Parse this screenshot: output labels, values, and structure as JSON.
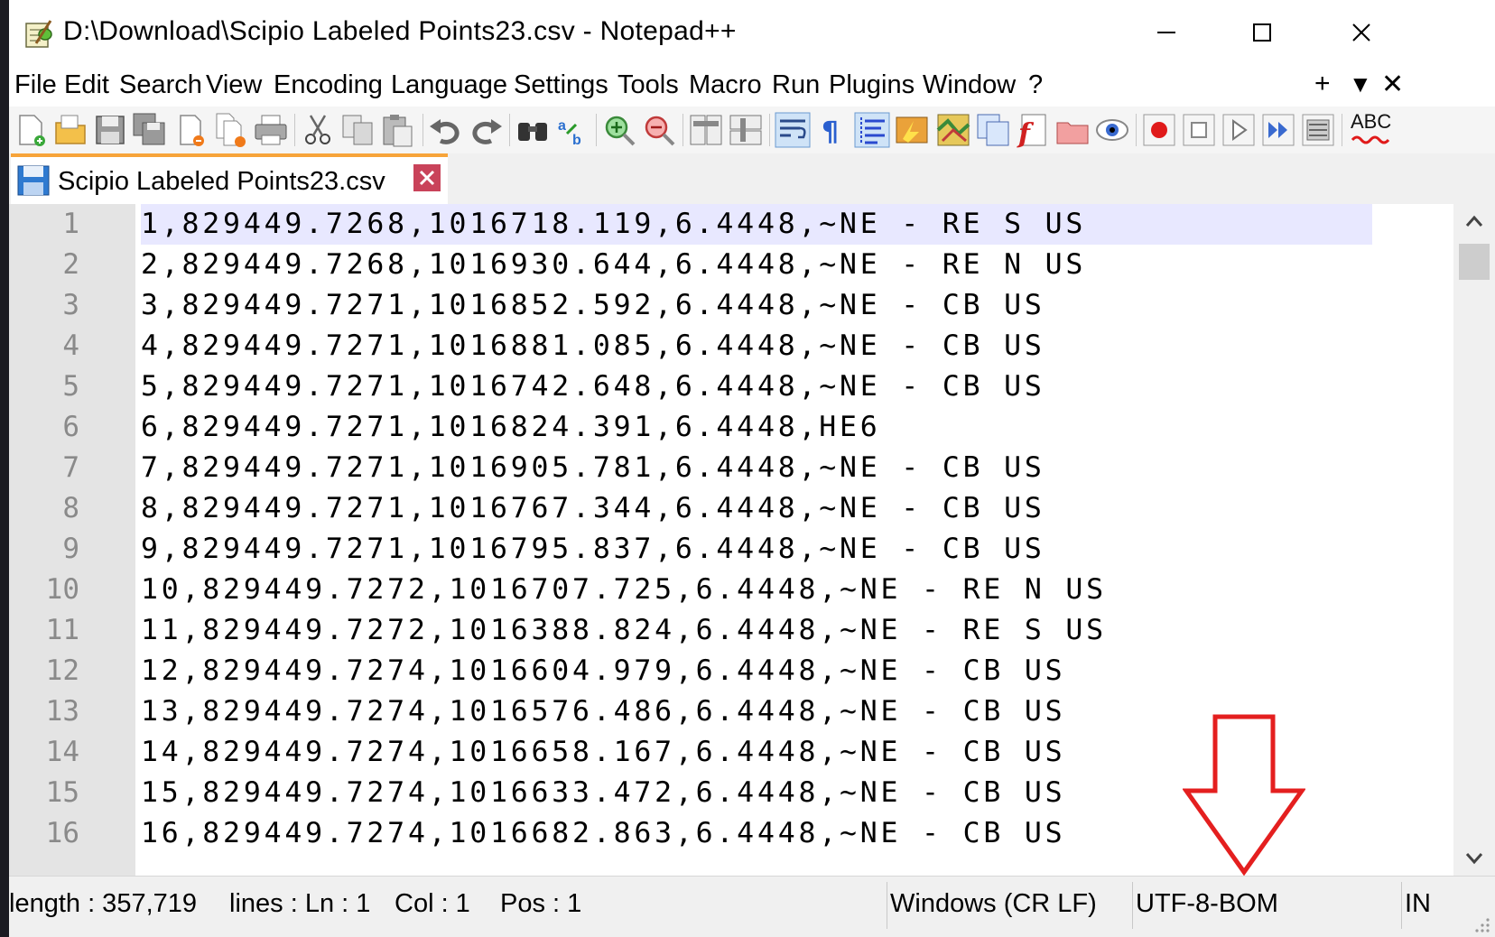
{
  "window": {
    "title": "D:\\Download\\Scipio Labeled Points23.csv - Notepad++"
  },
  "menu": [
    "File",
    "Edit",
    "Search",
    "View",
    "Encoding",
    "Language",
    "Settings",
    "Tools",
    "Macro",
    "Run",
    "Plugins",
    "Window",
    "?"
  ],
  "menu_right": {
    "add": "+",
    "down": "▼",
    "close": "✕"
  },
  "toolbar": {
    "icons": [
      "new-file-icon",
      "open-file-icon",
      "save-icon",
      "save-all-icon",
      "close-icon",
      "close-all-icon",
      "print-icon",
      "cut-icon",
      "copy-icon",
      "paste-icon",
      "undo-icon",
      "redo-icon",
      "find-icon",
      "replace-icon",
      "zoom-in-icon",
      "zoom-out-icon",
      "sync-vertical-icon",
      "sync-horizontal-icon",
      "word-wrap-icon",
      "show-all-chars-icon",
      "indent-guide-icon",
      "udl-icon",
      "doc-map-icon",
      "doc-list-icon",
      "function-list-icon",
      "folder-workspace-icon",
      "monitoring-icon",
      "record-macro-icon",
      "stop-record-icon",
      "play-macro-icon",
      "run-macro-multiple-icon",
      "save-macro-icon",
      "spellcheck-icon"
    ],
    "spellcheck_label": "ABC"
  },
  "tab": {
    "label": "Scipio Labeled Points23.csv"
  },
  "editor": {
    "lines": [
      {
        "n": "1",
        "text": "1,829449.7268,1016718.119,6.4448,~NE - RE S US"
      },
      {
        "n": "2",
        "text": "2,829449.7268,1016930.644,6.4448,~NE - RE N US"
      },
      {
        "n": "3",
        "text": "3,829449.7271,1016852.592,6.4448,~NE - CB US"
      },
      {
        "n": "4",
        "text": "4,829449.7271,1016881.085,6.4448,~NE - CB US"
      },
      {
        "n": "5",
        "text": "5,829449.7271,1016742.648,6.4448,~NE - CB US"
      },
      {
        "n": "6",
        "text": "6,829449.7271,1016824.391,6.4448,HE6"
      },
      {
        "n": "7",
        "text": "7,829449.7271,1016905.781,6.4448,~NE - CB US"
      },
      {
        "n": "8",
        "text": "8,829449.7271,1016767.344,6.4448,~NE - CB US"
      },
      {
        "n": "9",
        "text": "9,829449.7271,1016795.837,6.4448,~NE - CB US"
      },
      {
        "n": "10",
        "text": "10,829449.7272,1016707.725,6.4448,~NE - RE N US"
      },
      {
        "n": "11",
        "text": "11,829449.7272,1016388.824,6.4448,~NE - RE S US"
      },
      {
        "n": "12",
        "text": "12,829449.7274,1016604.979,6.4448,~NE - CB US"
      },
      {
        "n": "13",
        "text": "13,829449.7274,1016576.486,6.4448,~NE - CB US"
      },
      {
        "n": "14",
        "text": "14,829449.7274,1016658.167,6.4448,~NE - CB US"
      },
      {
        "n": "15",
        "text": "15,829449.7274,1016633.472,6.4448,~NE - CB US"
      },
      {
        "n": "16",
        "text": "16,829449.7274,1016682.863,6.4448,~NE - CB US"
      }
    ]
  },
  "status": {
    "length": "length : 357,719",
    "lines": "lines : Ln : 1",
    "col": "Col : 1",
    "pos": "Pos : 1",
    "eol": "Windows (CR LF)",
    "encoding": "UTF-8-BOM",
    "mode": "IN"
  },
  "colors": {
    "tab_accent": "#f7a43a",
    "current_line": "#e8e8ff",
    "annotation_arrow": "#e41f1f"
  }
}
